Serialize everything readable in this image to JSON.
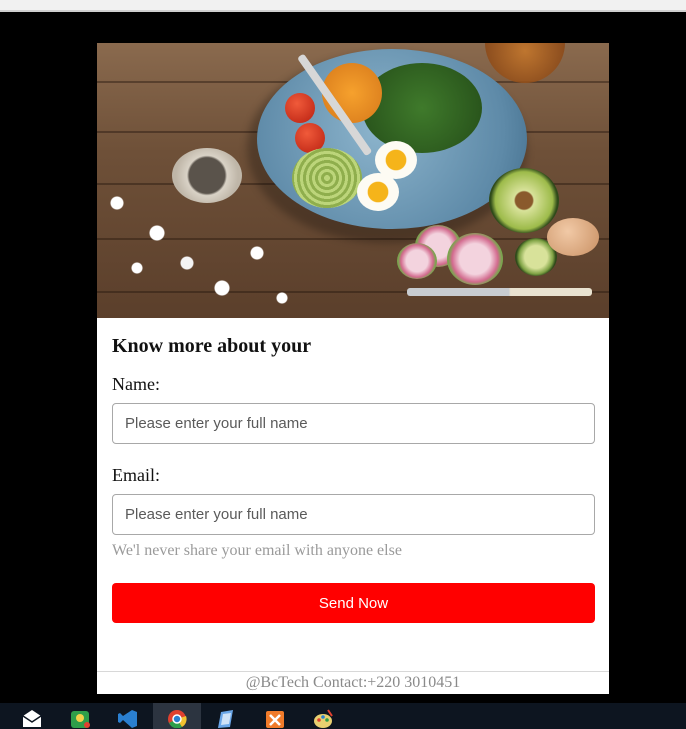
{
  "form": {
    "title": "Know more about your",
    "name_label": "Name:",
    "name_placeholder": "Please enter your full name",
    "email_label": "Email:",
    "email_placeholder": "Please enter your full name",
    "email_help": "We'l never share your email with anyone else",
    "submit_label": "Send Now"
  },
  "footer": {
    "text": "@BcTech Contact:+220 3010451"
  },
  "taskbar": {
    "apps": [
      {
        "icon": "mail-icon",
        "color": "#ffffff"
      },
      {
        "icon": "maps-icon",
        "color": "#2e9e4a"
      },
      {
        "icon": "vscode-icon",
        "color": "#2a7fd0"
      },
      {
        "icon": "chrome-icon",
        "color": "#e0402f"
      },
      {
        "icon": "notes-icon",
        "color": "#6aa6e8"
      },
      {
        "icon": "xampp-icon",
        "color": "#f07b2a"
      },
      {
        "icon": "paint-icon",
        "color": "#e8d070"
      }
    ]
  }
}
